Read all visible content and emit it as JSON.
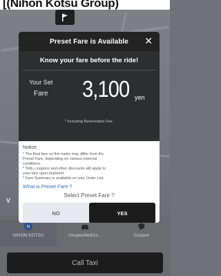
{
  "banner": {
    "text": "[(Nihon Kotsu Group)"
  },
  "modal": {
    "title": "Preset Fare is Available",
    "close_label": "✕",
    "headline": "Know your fare before the ride!",
    "set_label_line1": "Your Set",
    "set_label_line2": "Fare",
    "amount": "3,100",
    "unit": "yen",
    "fee_note": "* Including Reservation Fee.",
    "notice_title": "Notice",
    "notice_lines": [
      "* The final fare on the meter may differ from the",
      "Preset Fare, depending on various external",
      "conditions.",
      "* Tolls, coupons and other discounts will apply to",
      "your fare upon payment.",
      "* Fare Summary is available on your Order List."
    ],
    "what_link": "What is Preset Fare ?",
    "select_label": "Select Preset Fare ?",
    "no_label": "NO",
    "yes_label": "YES"
  },
  "background": {
    "side_letter": "V",
    "services": [
      {
        "label": "NIHON KOTSU",
        "icon": "nihon-kotsu-icon",
        "active": true
      },
      {
        "label": "Unspecified/1c...",
        "icon": "car-icon",
        "active": false
      },
      {
        "label": "Coupon",
        "icon": "coupon-icon",
        "active": false
      }
    ],
    "call_label": "Call Taxi"
  },
  "colors": {
    "header": "#232323",
    "fare_bg": "#2d2e30",
    "link": "#3d6fb0",
    "yes_bg": "#1c1c1c",
    "no_bg": "#e6e9ee"
  }
}
